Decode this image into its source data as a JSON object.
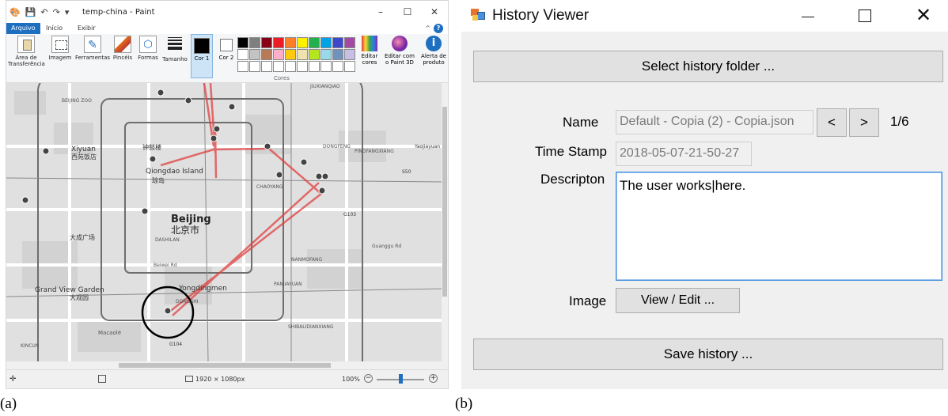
{
  "captions": {
    "a": "(a)",
    "b": "(b)"
  },
  "paint": {
    "window_title": "temp-china - Paint",
    "tabs": [
      "Arquivo",
      "Início",
      "Exibir"
    ],
    "ribbon": {
      "clipboard": "Área de Transferência",
      "image": "Imagem",
      "tools": "Ferramentas",
      "brushes": "Pincéis",
      "shapes": "Formas",
      "size": "Tamanho",
      "color1": "Cor 1",
      "color2": "Cor 2",
      "colors_group": "Cores",
      "edit_colors": "Editar cores",
      "edit_paint3d": "Editar com o Paint 3D",
      "product_alert": "Alerta de produto"
    },
    "palette": [
      "#000000",
      "#7f7f7f",
      "#880015",
      "#ed1c24",
      "#ff7f27",
      "#fff200",
      "#22b14c",
      "#00a2e8",
      "#3f48cc",
      "#a349a4",
      "#ffffff",
      "#c3c3c3",
      "#b97a57",
      "#ffaec9",
      "#ffc90e",
      "#efe4b0",
      "#b5e61d",
      "#99d9ea",
      "#7092be",
      "#c8bfe7",
      "#ffffff",
      "#ffffff",
      "#ffffff",
      "#ffffff",
      "#ffffff",
      "#ffffff",
      "#ffffff",
      "#ffffff",
      "#ffffff",
      "#ffffff"
    ],
    "status": {
      "dimensions": "1920 × 1080px",
      "zoom": "100%"
    },
    "map": {
      "labels": [
        {
          "text": "BEIJING ZOO",
          "k": "l1"
        },
        {
          "text": "Xiyuan",
          "k": "l2"
        },
        {
          "text": "西苑饭店",
          "k": "l3"
        },
        {
          "text": "Qiongdao Island",
          "k": "l4"
        },
        {
          "text": "琼岛",
          "k": "l5"
        },
        {
          "text": "Beijing",
          "k": "l6"
        },
        {
          "text": "北京市",
          "k": "l7"
        },
        {
          "text": "大成广场",
          "k": "l8"
        },
        {
          "text": "Grand View Garden",
          "k": "l9"
        },
        {
          "text": "大观园",
          "k": "l10"
        },
        {
          "text": "Yongdingmen",
          "k": "l11"
        },
        {
          "text": "钟鼓楼",
          "k": "l12"
        },
        {
          "text": "Macaolé",
          "k": "l13"
        },
        {
          "text": "KINCUN",
          "k": "l14"
        },
        {
          "text": "Yaojiayuan",
          "k": "l15"
        },
        {
          "text": "CHAOYANG",
          "k": "l16"
        },
        {
          "text": "DONGFENG",
          "k": "l17"
        },
        {
          "text": "SHIBALIDIANXIANG",
          "k": "l18"
        },
        {
          "text": "PANJIAYUAN",
          "k": "l19"
        },
        {
          "text": "NANMOFANG",
          "k": "l20"
        },
        {
          "text": "DASHILAN",
          "k": "l21"
        },
        {
          "text": "DONGSHI",
          "k": "l22"
        },
        {
          "text": "Guanggu Rd",
          "k": "l23"
        },
        {
          "text": "Beiwei Rd",
          "k": "l24"
        },
        {
          "text": "S50",
          "k": "l25"
        },
        {
          "text": "G103",
          "k": "l26"
        },
        {
          "text": "G104",
          "k": "l27"
        },
        {
          "text": "PINGFANGXIANG",
          "k": "l28"
        },
        {
          "text": "JIUXIANQIAO",
          "k": "l29"
        }
      ]
    }
  },
  "history": {
    "window_title": "History Viewer",
    "select_button": "Select history folder ...",
    "name_label": "Name",
    "name_value": "Default - Copia (2) - Copia.json",
    "prev_button": "<",
    "next_button": ">",
    "counter": "1/6",
    "timestamp_label": "Time Stamp",
    "timestamp_value": "2018-05-07-21-50-27",
    "description_label": "Descripton",
    "description_value": "The user works|here.",
    "image_label": "Image",
    "view_edit_button": "View / Edit ...",
    "save_button": "Save history ..."
  }
}
